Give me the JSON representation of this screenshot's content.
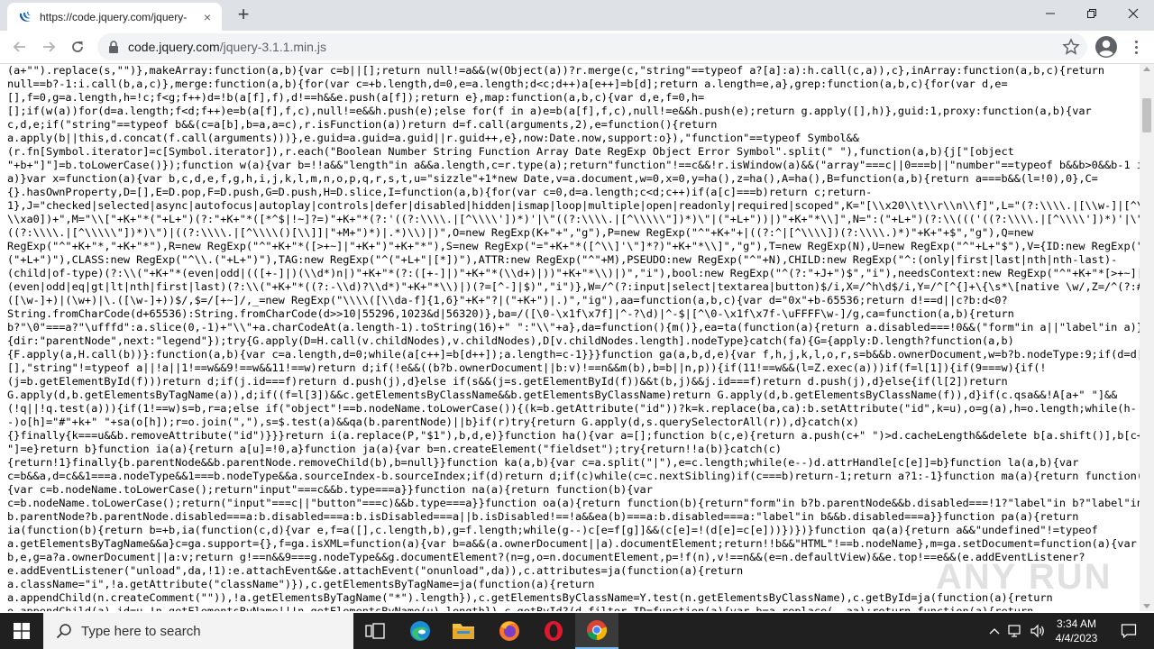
{
  "browser": {
    "tab_title": "https://code.jquery.com/jquery-",
    "tab_close": "×",
    "new_tab": "+",
    "url_host": "code.jquery.com",
    "url_path": "/jquery-3.1.1.min.js"
  },
  "code_lines": [
    "(a+\"\").replace(s,\"\")},makeArray:function(a,b){var c=b||[];return null!=a&&(w(Object(a))?r.merge(c,\"string\"==typeof a?[a]:a):h.call(c,a)),c},inArray:function(a,b,c){return",
    "null==b?-1:i.call(b,a,c)},merge:function(a,b){for(var c=+b.length,d=0,e=a.length;d<c;d++)a[e++]=b[d];return a.length=e,a},grep:function(a,b,c){for(var d,e=",
    "[],f=0,g=a.length,h=!c;f<g;f++)d=!b(a[f],f),d!==h&&e.push(a[f]);return e},map:function(a,b,c){var d,e,f=0,h=",
    "[];if(w(a))for(d=a.length;f<d;f++)e=b(a[f],f,c),null!=e&&h.push(e);else for(f in a)e=b(a[f],f,c),null!=e&&h.push(e);return g.apply([],h)},guid:1,proxy:function(a,b){var",
    "c,d,e;if(\"string\"==typeof b&&(c=a[b],b=a,a=c),r.isFunction(a))return d=f.call(arguments,2),e=function(){return",
    "a.apply(b||this,d.concat(f.call(arguments)))},e.guid=a.guid=a.guid||r.guid++,e},now:Date.now,support:o}),\"function\"==typeof Symbol&&",
    "(r.fn[Symbol.iterator]=c[Symbol.iterator]),r.each(\"Boolean Number String Function Array Date RegExp Object Error Symbol\".split(\" \"),function(a,b){j[\"[object",
    "\"+b+\"]\"]=b.toLowerCase()});function w(a){var b=!!a&&\"length\"in a&&a.length,c=r.type(a);return\"function\"!==c&&!r.isWindow(a)&&(\"array\"===c||0===b||\"number\"==typeof b&&b>0&&b-1 in",
    "a)}var x=function(a){var b,c,d,e,f,g,h,i,j,k,l,m,n,o,p,q,r,s,t,u=\"sizzle\"+1*new Date,v=a.document,w=0,x=0,y=ha(),z=ha(),A=ha(),B=function(a,b){return a===b&&(l=!0),0},C=",
    "{}.hasOwnProperty,D=[],E=D.pop,F=D.push,G=D.push,H=D.slice,I=function(a,b){for(var c=0,d=a.length;c<d;c++)if(a[c]===b)return c;return-",
    "1},J=\"checked|selected|async|autofocus|autoplay|controls|defer|disabled|hidden|ismap|loop|multiple|open|readonly|required|scoped\",K=\"[\\\\x20\\\\t\\\\r\\\\n\\\\f]\",L=\"(?:\\\\\\\\.|[\\\\w-]|[^\\0-",
    "\\\\xa0])+\",M=\"\\\\[\"+K+\"*(\"+L+\")(?:\"+K+\"*([*^$|!~]?=)\"+K+\"*(?:'((?:\\\\\\\\.|[^\\\\\\\\'])*)'|\\\"((?:\\\\\\\\.|[^\\\\\\\\\\\"])*)\\\"|(\"+L+\"))|)\"+K+\"*\\\\]\",N=\":(\"+L+\")(?:\\\\((('((?:\\\\\\\\.|[^\\\\\\\\'])*)'|\\\"",
    "((?:\\\\\\\\.|[^\\\\\\\\\\\"])*)\\\")|((?:\\\\\\\\.|[^\\\\\\\\()[\\\\]]|\"+M+\")*)|.*)\\\\)|)\",O=new RegExp(K+\"+\",\"g\"),P=new RegExp(\"^\"+K+\"+|((?:^|[^\\\\\\\\])(?:\\\\\\\\.)*)\"+K+\"+$\",\"g\"),Q=new",
    "RegExp(\"^\"+K+\"*,\"+K+\"*\"),R=new RegExp(\"^\"+K+\"*([>+~]|\"+K+\")\"+K+\"*\"),S=new RegExp(\"=\"+K+\"*([^\\\\]'\\\"]*?)\"+K+\"*\\\\]\",\"g\"),T=new RegExp(N),U=new RegExp(\"^\"+L+\"$\"),V={ID:new RegExp(\"^#",
    "(\"+L+\")\"),CLASS:new RegExp(\"^\\\\.(\"+L+\")\"),TAG:new RegExp(\"^(\"+L+\"|[*])\"),ATTR:new RegExp(\"^\"+M),PSEUDO:new RegExp(\"^\"+N),CHILD:new RegExp(\"^:(only|first|last|nth|nth-last)-",
    "(child|of-type)(?:\\\\(\"+K+\"*(even|odd|(([+-]|)(\\\\d*)n|)\"+K+\"*(?:([+-]|)\"+K+\"*(\\\\d+)|))\"+K+\"*\\\\)|)\",\"i\"),bool:new RegExp(\"^(?:\"+J+\")$\",\"i\"),needsContext:new RegExp(\"^\"+K+\"*[>+~]|:",
    "(even|odd|eq|gt|lt|nth|first|last)(?:\\\\(\"+K+\"*((?:-\\\\d)?\\\\d*)\"+K+\"*\\\\)|)(?=[^-]|$)\",\"i\")},W=/^(?:input|select|textarea|button)$/i,X=/^h\\d$/i,Y=/^[^{]+\\{\\s*\\[native \\w/,Z=/^(?:#",
    "([\\w-]+)|(\\w+)|\\.([\\w-]+))$/,$=/[+~]/,_=new RegExp(\"\\\\\\\\([\\\\da-f]{1,6}\"+K+\"?|(\"+K+\")|.)\",\"ig\"),aa=function(a,b,c){var d=\"0x\"+b-65536;return d!==d||c?b:d<0?",
    "String.fromCharCode(d+65536):String.fromCharCode(d>>10|55296,1023&d|56320)},ba=/([\\0-\\x1f\\x7f]|^-?\\d)|^-$|[^\\0-\\x1f\\x7f-\\uFFFF\\w-]/g,ca=function(a,b){return",
    "b?\"\\0\"===a?\"\\ufffd\":a.slice(0,-1)+\"\\\\\"+a.charCodeAt(a.length-1).toString(16)+\" \":\"\\\\\"+a},da=function(){m()},ea=ta(function(a){return a.disabled===!0&&(\"form\"in a||\"label\"in a)},",
    "{dir:\"parentNode\",next:\"legend\"});try{G.apply(D=H.call(v.childNodes),v.childNodes),D[v.childNodes.length].nodeType}catch(fa){G={apply:D.length?function(a,b)",
    "{F.apply(a,H.call(b))}:function(a,b){var c=a.length,d=0;while(a[c++]=b[d++]);a.length=c-1}}}function ga(a,b,d,e){var f,h,j,k,l,o,r,s=b&&b.ownerDocument,w=b?b.nodeType:9;if(d=d||",
    "[],\"string\"!=typeof a||!a||1!==w&&9!==w&&11!==w)return d;if(!e&&((b?b.ownerDocument||b:v)!==n&&m(b),b=b||n,p)){if(11!==w&&(l=Z.exec(a)))if(f=l[1]){if(9===w){if(!",
    "(j=b.getElementById(f)))return d;if(j.id===f)return d.push(j),d}else if(s&&(j=s.getElementById(f))&&t(b,j)&&j.id===f)return d.push(j),d}else{if(l[2])return",
    "G.apply(d,b.getElementsByTagName(a)),d;if((f=l[3])&&c.getElementsByClassName&&b.getElementsByClassName)return G.apply(d,b.getElementsByClassName(f)),d}if(c.qsa&&!A[a+\" \"]&&",
    "(!q||!q.test(a))){if(1!==w)s=b,r=a;else if(\"object\"!==b.nodeName.toLowerCase()){(k=b.getAttribute(\"id\"))?k=k.replace(ba,ca):b.setAttribute(\"id\",k=u),o=g(a),h=o.length;while(h-",
    "-)o[h]=\"#\"+k+\" \"+sa(o[h]);r=o.join(\",\"),s=$.test(a)&&qa(b.parentNode)||b}if(r)try{return G.apply(d,s.querySelectorAll(r)),d}catch(x)",
    "{}finally{k===u&&b.removeAttribute(\"id\")}}}return i(a.replace(P,\"$1\"),b,d,e)}function ha(){var a=[];function b(c,e){return a.push(c+\" \")>d.cacheLength&&delete b[a.shift()],b[c+\"",
    "\"]=e}return b}function ia(a){return a[u]=!0,a}function ja(a){var b=n.createElement(\"fieldset\");try{return!!a(b)}catch(c)",
    "{return!1}finally{b.parentNode&&b.parentNode.removeChild(b),b=null}}function ka(a,b){var c=a.split(\"|\"),e=c.length;while(e--)d.attrHandle[c[e]]=b}function la(a,b){var",
    "c=b&&a,d=c&&1===a.nodeType&&1===b.nodeType&&a.sourceIndex-b.sourceIndex;if(d)return d;if(c)while(c=c.nextSibling)if(c===b)return-1;return a?1:-1}function ma(a){return function(b)",
    "{var c=b.nodeName.toLowerCase();return\"input\"===c&&b.type===a}}function na(a){return function(b){var",
    "c=b.nodeName.toLowerCase();return(\"input\"===c||\"button\"===c)&&b.type===a}}function oa(a){return function(b){return\"form\"in b?b.parentNode&&b.disabled===!1?\"label\"in b?\"label\"in",
    "b.parentNode?b.parentNode.disabled===a:b.disabled===a:b.isDisabled===a||b.isDisabled!==!a&&ea(b)===a:b.disabled===a:\"label\"in b&&b.disabled===a}}function pa(a){return",
    "ia(function(b){return b=+b,ia(function(c,d){var e,f=a([],c.length,b),g=f.length;while(g--)c[e=f[g]]&&(c[e]=!(d[e]=c[e]))})})}function qa(a){return a&&\"undefined\"!=typeof",
    "a.getElementsByTagName&&a}c=ga.support={},f=ga.isXML=function(a){var b=a&&(a.ownerDocument||a).documentElement;return!!b&&\"HTML\"!==b.nodeName},m=ga.setDocument=function(a){var",
    "b,e,g=a?a.ownerDocument||a:v;return g!==n&&9===g.nodeType&&g.documentElement?(n=g,o=n.documentElement,p=!f(n),v!==n&&(e=n.defaultView)&&e.top!==e&&(e.addEventListener?",
    "e.addEventListener(\"unload\",da,!1):e.attachEvent&&e.attachEvent(\"onunload\",da)),c.attributes=ja(function(a){return",
    "a.className=\"i\",!a.getAttribute(\"className\")}),c.getElementsByTagName=ja(function(a){return",
    "a.appendChild(n.createComment(\"\")),!a.getElementsByTagName(\"*\").length}),c.getElementsByClassName=Y.test(n.getElementsByClassName),c.getById=ja(function(a){return",
    "o.appendChild(a).id=u,!n.getElementsByName||!n.getElementsByName(u).length}),c.getById?(d.filter.ID=function(a){var b=a.replace(_,aa);return function(a){return"
  ],
  "watermark": "ANY RUN",
  "taskbar": {
    "search_placeholder": "Type here to search",
    "time": "3:34 AM",
    "date": "4/4/2023"
  },
  "colors": {
    "chrome_tab_bar": "#dee1e6",
    "taskbar": "#202020",
    "accent": "#76b9ed"
  }
}
